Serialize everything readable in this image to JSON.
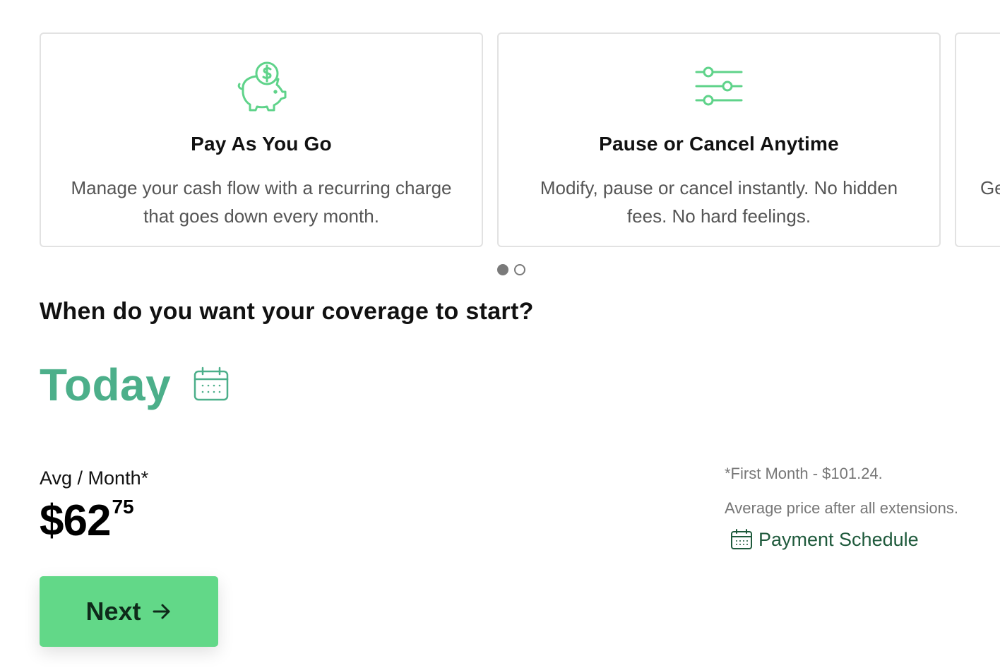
{
  "carousel": {
    "cards": [
      {
        "icon": "piggy-bank-icon",
        "title": "Pay As You Go",
        "description": "Manage your cash flow with a recurring charge that goes down every month."
      },
      {
        "icon": "sliders-icon",
        "title": "Pause or Cancel Anytime",
        "description": "Modify, pause or cancel instantly. No hidden fees. No hard feelings."
      },
      {
        "icon": "",
        "title": "",
        "description": "Ge"
      }
    ],
    "page_count": 2,
    "active_page": 1
  },
  "coverage": {
    "question": "When do you want your coverage to start?",
    "start_value": "Today",
    "calendar_icon": "calendar-icon"
  },
  "pricing": {
    "avg_label": "Avg / Month*",
    "price_main": "$62",
    "price_cents": "75",
    "first_month_note": "*First Month - $101.24.",
    "average_note": "Average price after all extensions.",
    "schedule_link": "Payment Schedule"
  },
  "actions": {
    "next_label": "Next",
    "next_icon": "arrow-right-icon"
  },
  "colors": {
    "accent_green": "#4caf8a",
    "icon_green": "#5fd38a",
    "button_green": "#62d888",
    "link_green": "#1f5a3c"
  }
}
